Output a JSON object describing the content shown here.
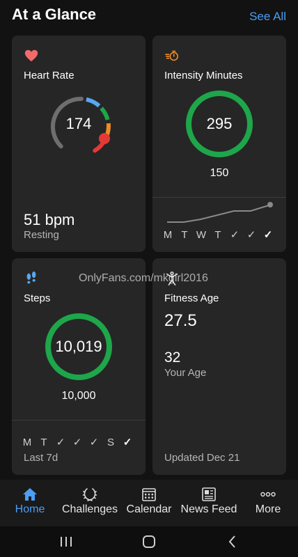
{
  "header": {
    "title": "At a Glance",
    "see_all": "See All"
  },
  "heart_rate": {
    "title": "Heart Rate",
    "value": "174",
    "resting_value": "51 bpm",
    "resting_label": "Resting",
    "icon": "heart-icon",
    "color": "#f26b6b"
  },
  "intensity": {
    "title": "Intensity Minutes",
    "value": "295",
    "goal": "150",
    "days": [
      "M",
      "T",
      "W",
      "T"
    ],
    "icon": "running-timer-icon",
    "ring_color": "#1ea64a"
  },
  "steps": {
    "title": "Steps",
    "value": "10,019",
    "goal": "10,000",
    "days": [
      "M",
      "T"
    ],
    "day_s": "S",
    "period": "Last 7d",
    "icon": "footsteps-icon"
  },
  "fitness_age": {
    "title": "Fitness Age",
    "value": "27.5",
    "your_age_value": "32",
    "your_age_label": "Your Age",
    "updated": "Updated Dec 21",
    "icon": "fitness-person-icon"
  },
  "watermark": "OnlyFans.com/mkgirl2016",
  "nav": {
    "home": "Home",
    "challenges": "Challenges",
    "calendar": "Calendar",
    "news_feed": "News Feed",
    "more": "More"
  },
  "colors": {
    "accent": "#4a9ef5",
    "green": "#1ea64a",
    "red": "#e53935",
    "orange": "#f08a24"
  }
}
